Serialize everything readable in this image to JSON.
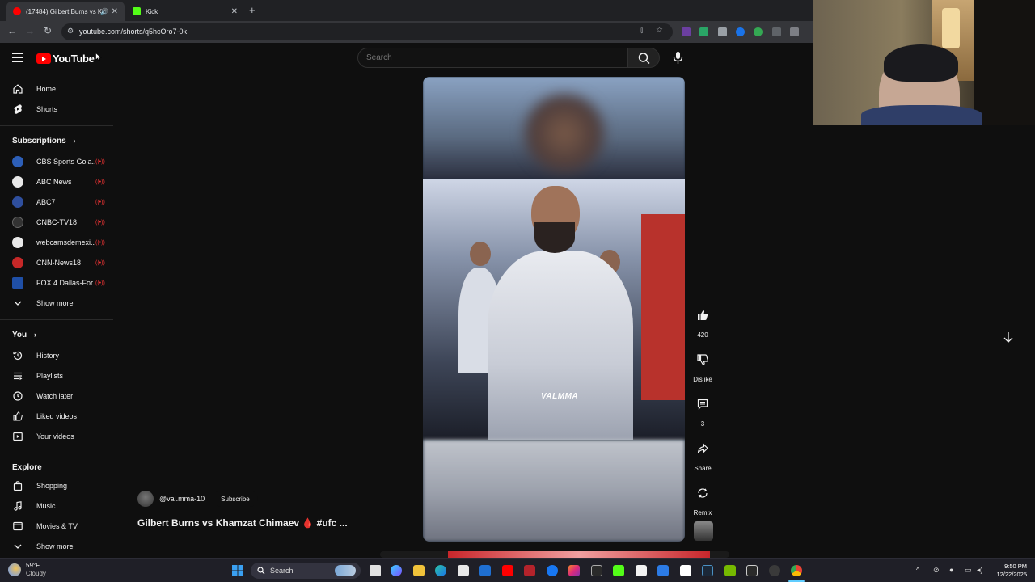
{
  "browser": {
    "tabs": [
      {
        "label": "(17484) Gilbert Burns vs Kh",
        "active": true
      },
      {
        "label": "Kick",
        "active": false
      }
    ],
    "url": "youtube.com/shorts/q5hcOro7-0k"
  },
  "header": {
    "logo_text": "YouTube",
    "search_placeholder": "Search"
  },
  "sidebar": {
    "main": [
      {
        "label": "Home",
        "icon": "home-icon"
      },
      {
        "label": "Shorts",
        "icon": "shorts-icon"
      }
    ],
    "subscriptions_title": "Subscriptions",
    "subscriptions": [
      {
        "label": "CBS Sports Gola...",
        "color": "#2d5fb8"
      },
      {
        "label": "ABC News",
        "color": "#e8e8e8"
      },
      {
        "label": "ABC7",
        "color": "#2f4f9e"
      },
      {
        "label": "CNBC-TV18",
        "color": "#333333"
      },
      {
        "label": "webcamsdemexi...",
        "color": "#e9e9e9"
      },
      {
        "label": "CNN-News18",
        "color": "#c62828"
      },
      {
        "label": "FOX 4 Dallas-For...",
        "color": "#1f4fa6"
      }
    ],
    "show_more": "Show more",
    "you_title": "You",
    "you_items": [
      {
        "label": "History",
        "icon": "history-icon"
      },
      {
        "label": "Playlists",
        "icon": "playlists-icon"
      },
      {
        "label": "Watch later",
        "icon": "watch-later-icon"
      },
      {
        "label": "Liked videos",
        "icon": "liked-videos-icon"
      },
      {
        "label": "Your videos",
        "icon": "your-videos-icon"
      }
    ],
    "explore_title": "Explore",
    "explore_items": [
      {
        "label": "Shopping",
        "icon": "shopping-icon"
      },
      {
        "label": "Music",
        "icon": "music-icon"
      },
      {
        "label": "Movies & TV",
        "icon": "movies-icon"
      }
    ],
    "show_more_2": "Show more"
  },
  "short": {
    "watermark": "VALMMA",
    "channel_handle": "@val.mma-10",
    "subscribe_label": "Subscribe",
    "title": "Gilbert Burns vs Khamzat Chimaev 🩸 #ufc ..."
  },
  "actions": {
    "likes": "420",
    "dislike": "Dislike",
    "comments": "3",
    "share": "Share",
    "remix": "Remix"
  },
  "taskbar": {
    "temperature": "59°F",
    "condition": "Cloudy",
    "search_label": "Search",
    "time": "9:50 PM",
    "date": "12/22/2025"
  }
}
